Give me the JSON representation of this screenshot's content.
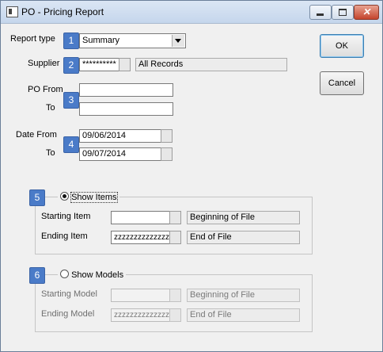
{
  "window": {
    "title": "PO - Pricing Report",
    "minimize_label": "",
    "close_glyph": "✕"
  },
  "badges": [
    "1",
    "2",
    "3",
    "4",
    "5",
    "6"
  ],
  "report_type": {
    "label": "Report type",
    "value": "Summary"
  },
  "supplier": {
    "label": "Supplier",
    "value": "**********",
    "description": "All Records"
  },
  "po": {
    "from_label": "PO From",
    "to_label": "To",
    "from_value": "",
    "to_value": ""
  },
  "date": {
    "from_label": "Date From",
    "to_label": "To",
    "from_value": "09/06/2014",
    "to_value": "09/07/2014"
  },
  "show_items": {
    "label": "Show Items",
    "selected": true,
    "starting_label": "Starting Item",
    "starting_value": "",
    "starting_desc": "Beginning of File",
    "ending_label": "Ending Item",
    "ending_value": "zzzzzzzzzzzzzzz",
    "ending_desc": "End of File"
  },
  "show_models": {
    "label": "Show Models",
    "selected": false,
    "starting_label": "Starting Model",
    "starting_value": "",
    "starting_desc": "Beginning of File",
    "ending_label": "Ending Model",
    "ending_value": "zzzzzzzzzzzzzzz",
    "ending_desc": "End of File"
  },
  "buttons": {
    "ok": "OK",
    "cancel": "Cancel"
  },
  "colors": {
    "badge": "#4a7bc8",
    "window_bg": "#f0f0f0",
    "titlebar": "#c5d6ec",
    "close_button": "#c4442c"
  }
}
